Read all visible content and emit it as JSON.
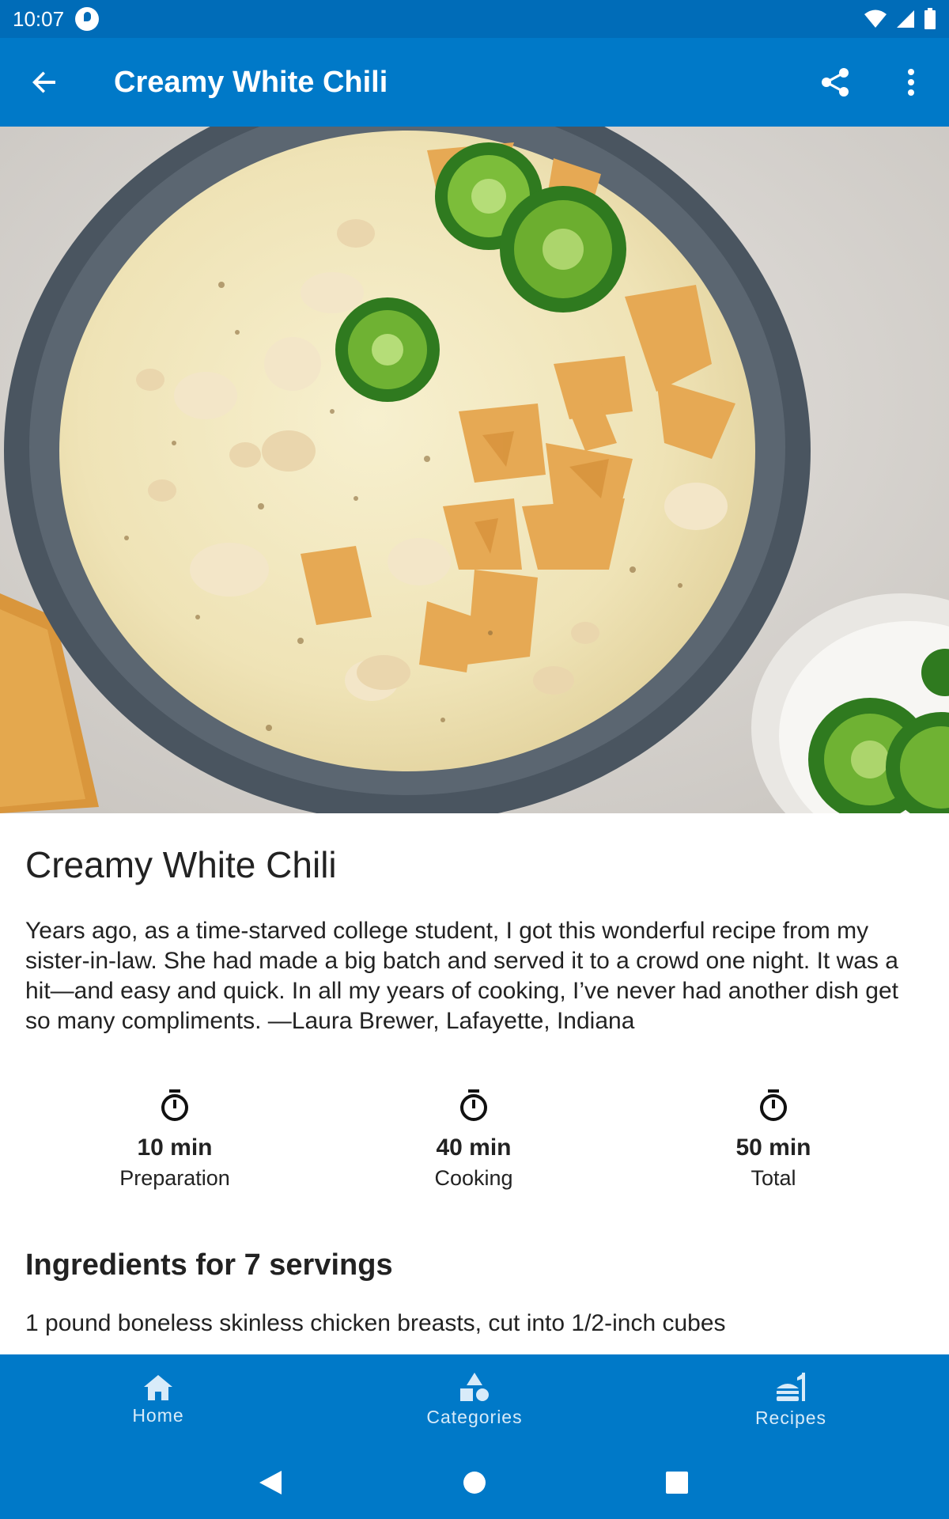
{
  "status_bar": {
    "time": "10:07"
  },
  "app_bar": {
    "title": "Creamy White Chili",
    "back_icon": "arrow-back-icon",
    "share_icon": "share-icon",
    "more_icon": "more-vert-icon"
  },
  "hero": {
    "description": "bowl-of-creamy-white-chili-photo"
  },
  "recipe": {
    "title": "Creamy White Chili",
    "description": "Years ago, as a time-starved college student, I got this wonderful recipe from my sister-in-law. She had made a big batch and served it to a crowd one night. It was a hit—and easy and quick. In all my years of cooking, I’ve never had another dish get so many compliments. —Laura Brewer, Lafayette, Indiana",
    "stats": [
      {
        "value": "10 min",
        "label": "Preparation",
        "icon": "timer-icon"
      },
      {
        "value": "40 min",
        "label": "Cooking",
        "icon": "timer-icon"
      },
      {
        "value": "50 min",
        "label": "Total",
        "icon": "timer-icon"
      }
    ],
    "ingredients_heading": "Ingredients for 7 servings",
    "ingredients": [
      "1 pound boneless skinless chicken breasts, cut into 1/2-inch cubes"
    ]
  },
  "bottom_nav": {
    "items": [
      {
        "label": "Home",
        "icon": "home-icon"
      },
      {
        "label": "Categories",
        "icon": "categories-icon"
      },
      {
        "label": "Recipes",
        "icon": "recipes-icon"
      }
    ]
  },
  "colors": {
    "status_bar": "#006cb8",
    "primary": "#0079c8",
    "nav_text": "#d8ebf9"
  }
}
